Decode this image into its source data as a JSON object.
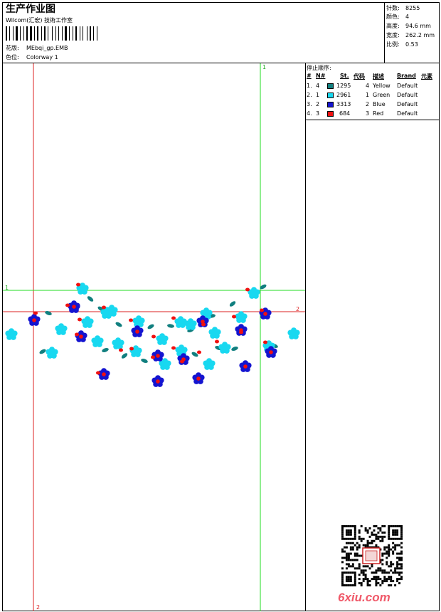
{
  "header": {
    "title": "生产作业图",
    "company": "Wilcom(汇宏) 技術工作室",
    "design_label": "花版:",
    "design_value": "MEbqi_gp.EMB",
    "colorway_label": "色位:",
    "colorway_value": "Colorway 1"
  },
  "stats": {
    "stitches": {
      "label": "针数:",
      "value": "8255"
    },
    "colors": {
      "label": "颜色:",
      "value": "4"
    },
    "height": {
      "label": "高度:",
      "value": "94.6 mm"
    },
    "width": {
      "label": "宽度:",
      "value": "262.2 mm"
    },
    "scale": {
      "label": "比例:",
      "value": "0.53"
    }
  },
  "stop_sequence": {
    "title": "停止顺序:",
    "headers": [
      "#",
      "N#",
      "St.",
      "代码",
      "描述",
      "Brand",
      "元素"
    ],
    "rows": [
      {
        "idx": "1.",
        "n": "4",
        "color": "#117f7f",
        "st": "1295",
        "code": "4",
        "desc": "Yellow",
        "brand": "Default"
      },
      {
        "idx": "2.",
        "n": "1",
        "color": "#18d8f0",
        "st": "2961",
        "code": "1",
        "desc": "Green",
        "brand": "Default"
      },
      {
        "idx": "3.",
        "n": "2",
        "color": "#1414d0",
        "st": "3313",
        "code": "2",
        "desc": "Blue",
        "brand": "Default"
      },
      {
        "idx": "4.",
        "n": "3",
        "color": "#f01010",
        "st": "684",
        "code": "3",
        "desc": "Red",
        "brand": "Default"
      }
    ]
  },
  "guides": {
    "v1_label": "1",
    "v2_label": "2",
    "h1_label": "1",
    "h2_label": "2",
    "green": "#22dd22",
    "red": "#dd2222"
  },
  "watermark": "6xiu.com"
}
